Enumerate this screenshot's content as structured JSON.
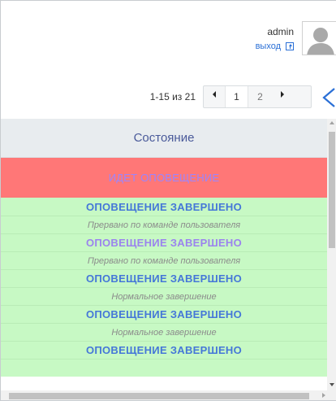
{
  "header": {
    "user_name": "admin",
    "logout_label": "выход"
  },
  "pager": {
    "range_text": "1-15 из 21",
    "pages": [
      "1",
      "2"
    ],
    "current_page": "1"
  },
  "table": {
    "column_header": "Состояние",
    "rows": [
      {
        "status": "ИДЕТ ОПОВЕЩЕНИЕ",
        "reason": "",
        "style": "alert"
      },
      {
        "status": "ОПОВЕЩЕНИЕ ЗАВЕРШЕНО",
        "reason": "Прервано по команде пользователя",
        "style": "done-blue"
      },
      {
        "status": "ОПОВЕЩЕНИЕ ЗАВЕРШЕНО",
        "reason": "Прервано по команде пользователя",
        "style": "done-purple"
      },
      {
        "status": "ОПОВЕЩЕНИЕ ЗАВЕРШЕНО",
        "reason": "Нормальное завершение",
        "style": "done-blue"
      },
      {
        "status": "ОПОВЕЩЕНИЕ ЗАВЕРШЕНО",
        "reason": "Нормальное завершение",
        "style": "done-blue"
      },
      {
        "status": "ОПОВЕЩЕНИЕ ЗАВЕРШЕНО",
        "reason": "",
        "style": "done-blue"
      }
    ]
  },
  "colors": {
    "alert_row_bg": "#ff7777",
    "alert_text": "#9a85ff",
    "done_row_bg": "#c7f9c4",
    "status_blue": "#4577d8",
    "status_purple": "#9b83ee",
    "header_bg": "#e8ecef",
    "link_blue": "#2a6fd6"
  },
  "icons": {
    "logout": "logout-icon",
    "avatar": "user-avatar-icon",
    "prev": "triangle-left-icon",
    "next": "triangle-right-icon",
    "back": "chevron-left-icon"
  }
}
